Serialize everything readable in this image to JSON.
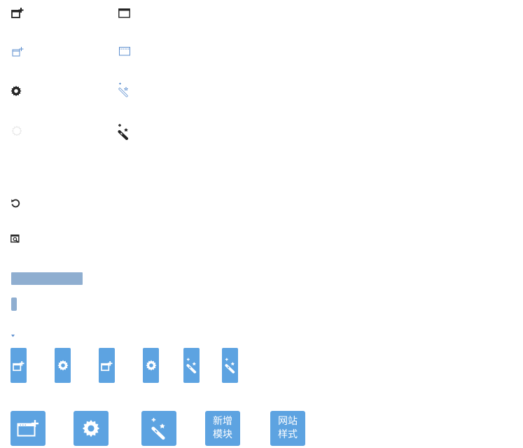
{
  "colors": {
    "accent": "#5DA3E1",
    "bar": "#8FAED0",
    "icon_dark": "#222222",
    "icon_blue": "#5D8FCF",
    "icon_faint": "#E4E4E4",
    "tile_text": "#FFFFFF"
  },
  "icons_column_left": [
    "add-module-icon",
    "add-module-outline-icon",
    "gear-icon",
    "gear-faint-icon",
    "undo-icon",
    "preview-icon"
  ],
  "icons_column_right": [
    "window-icon",
    "window-outline-icon",
    "magic-wand-outline-icon",
    "magic-wand-icon"
  ],
  "toolbar_tabs": [
    "add-module-icon",
    "gear-icon",
    "add-module-icon",
    "gear-icon",
    "magic-wand-icon",
    "magic-wand-icon"
  ],
  "tiles": {
    "add_module_line1": "新增",
    "add_module_line2": "模块",
    "site_style_line1": "网站",
    "site_style_line2": "样式"
  }
}
